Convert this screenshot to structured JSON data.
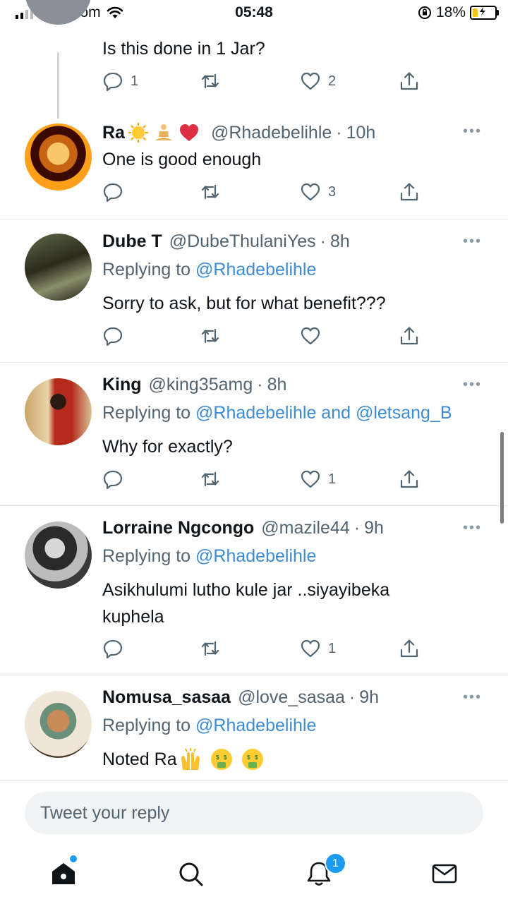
{
  "status_bar": {
    "carrier": "Vodacom",
    "time": "05:48",
    "battery_percent": "18%",
    "signal_bars_filled": 2,
    "signal_bars_total": 4,
    "battery_level": 0.18,
    "battery_color": "#f6c21a"
  },
  "colors": {
    "accent": "#1d9bf0",
    "mention": "#3d8bd3",
    "muted": "#536471"
  },
  "tweets": [
    {
      "text": "Is this done in 1 Jar?",
      "stats": {
        "replies": "1",
        "retweets": "",
        "likes": "2"
      }
    },
    {
      "name": "Ra",
      "name_emojis": [
        "sun-emoji",
        "lotus-position-emoji",
        "red-heart-emoji"
      ],
      "handle": "@Rhadebelihle",
      "time": "10h",
      "text": "One is good enough",
      "stats": {
        "replies": "",
        "retweets": "",
        "likes": "3"
      }
    },
    {
      "name": "Dube T",
      "handle": "@DubeThulaniYes",
      "time": "8h",
      "replying_label": "Replying to",
      "replying_to": "@Rhadebelihle",
      "text": "Sorry to ask, but for what benefit???",
      "stats": {
        "replies": "",
        "retweets": "",
        "likes": ""
      }
    },
    {
      "name": "King",
      "handle": "@king35amg",
      "time": "8h",
      "replying_label": "Replying to",
      "replying_to": "@Rhadebelihle and @letsang_B",
      "text": "Why for exactly?",
      "stats": {
        "replies": "",
        "retweets": "",
        "likes": "1"
      }
    },
    {
      "name": "Lorraine Ngcongo",
      "handle": "@mazile44",
      "time": "9h",
      "replying_label": "Replying to",
      "replying_to": "@Rhadebelihle",
      "text": "Asikhulumi lutho kule jar ..siyayibeka kuphela",
      "stats": {
        "replies": "",
        "retweets": "",
        "likes": "1"
      }
    },
    {
      "name": "Nomusa_sasaa",
      "handle": "@love_sasaa",
      "time": "9h",
      "replying_label": "Replying to",
      "replying_to": "@Rhadebelihle",
      "text": "Noted Ra",
      "text_emojis": [
        "raising-hands-emoji",
        "money-mouth-face-emoji",
        "money-mouth-face-emoji"
      ]
    }
  ],
  "composer": {
    "placeholder": "Tweet your reply"
  },
  "tab_bar": {
    "items": [
      "home-icon",
      "search-icon",
      "notifications-icon",
      "messages-icon"
    ],
    "notifications_badge": "1"
  }
}
